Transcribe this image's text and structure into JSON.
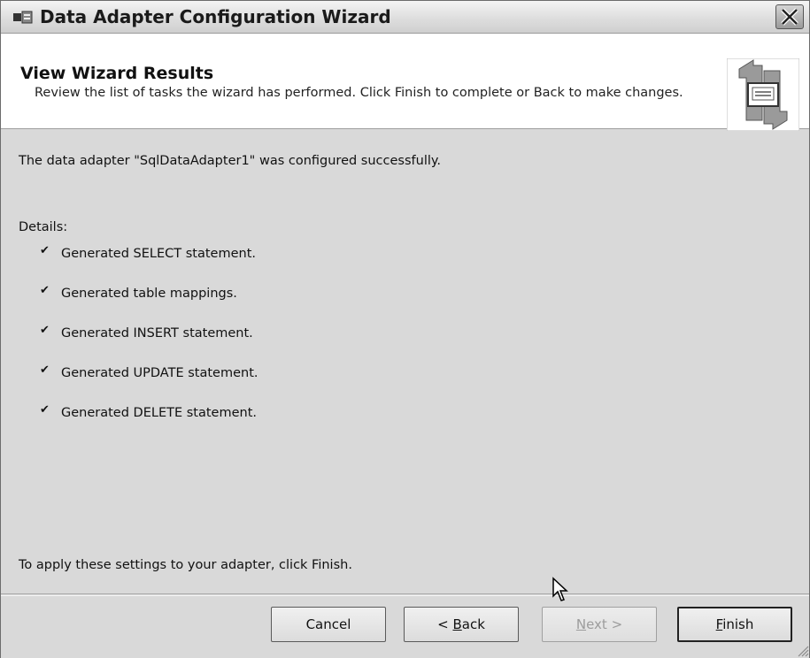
{
  "window": {
    "title": "Data Adapter Configuration Wizard"
  },
  "header": {
    "title": "View Wizard Results",
    "subtitle": "Review the list of tasks the wizard has performed. Click Finish to complete or Back to make changes."
  },
  "content": {
    "status_message": "The data adapter \"SqlDataAdapter1\" was configured successfully.",
    "details_label": "Details:",
    "tasks": [
      "Generated SELECT statement.",
      "Generated table mappings.",
      "Generated INSERT statement.",
      "Generated UPDATE statement.",
      "Generated DELETE statement."
    ],
    "apply_hint": "To apply these settings to your adapter, click Finish."
  },
  "buttons": {
    "cancel": "Cancel",
    "back_prefix": "< ",
    "back_mnemonic": "B",
    "back_rest": "ack",
    "next_mnemonic": "N",
    "next_rest": "ext >",
    "finish_mnemonic": "F",
    "finish_rest": "inish"
  },
  "icons": {
    "app": "data-adapter-icon",
    "close": "close-icon",
    "header": "wizard-sync-graphic",
    "check": "checkmark-icon",
    "cursor": "mouse-pointer-icon",
    "grip": "resize-grip-icon"
  }
}
